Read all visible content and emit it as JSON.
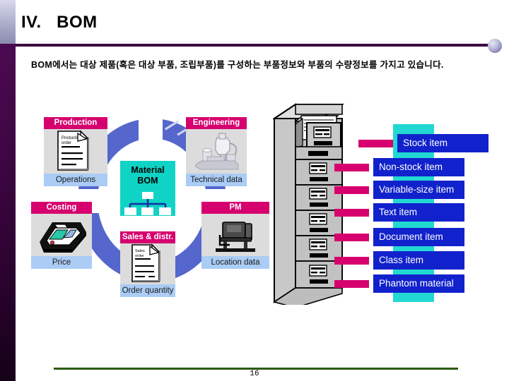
{
  "slide": {
    "title": "IV.   BOM",
    "lead_text": "BOM에서는 대상 제품(혹은 대상 부품, 조립부품)를 구성하는 부품정보와 부품의 수량정보를 가지고 있습니다.",
    "page_number": "16"
  },
  "colors": {
    "module_header": "#d6006e",
    "module_footer": "#aaccf5",
    "module_body": "#dcdcdc",
    "ring_blue": "#5566cc",
    "bom_cyan": "#0fd3c4",
    "item_chip_blue": "#1122cc",
    "item_panel_cyan": "#22d8d2",
    "connector_magenta": "#d6006e",
    "title_rule_purple": "#3d0640",
    "footer_rule_green": "#2d5a10",
    "left_bar_purple": "#3d0642"
  },
  "center": {
    "label_line1": "Material",
    "label_line2": "BOM",
    "icon": "hierarchy-tree-icon"
  },
  "modules": [
    {
      "id": "production",
      "header": "Production",
      "footer": "Operations",
      "icon": "production-order-document-icon",
      "icon_caption": "Production order"
    },
    {
      "id": "engineering",
      "header": "Engineering",
      "footer": "Technical data",
      "icon": "machine-assembly-icon"
    },
    {
      "id": "costing",
      "header": "Costing",
      "footer": "Price",
      "icon": "calculator-icon"
    },
    {
      "id": "pm",
      "header": "PM",
      "footer": "Location data",
      "icon": "machine-equipment-icon"
    },
    {
      "id": "sales",
      "header": "Sales & distr.",
      "footer": "Order quantity",
      "icon": "sales-order-document-icon",
      "icon_caption": "Sales order"
    }
  ],
  "cabinet": {
    "icon": "filing-cabinet-icon",
    "drawer_count": 6,
    "open_drawer_index": 0
  },
  "items": [
    {
      "label": "Stock item"
    },
    {
      "label": "Non-stock item"
    },
    {
      "label": "Variable-size item"
    },
    {
      "label": "Text item"
    },
    {
      "label": "Document item"
    },
    {
      "label": "Class item"
    },
    {
      "label": "Phantom material"
    }
  ]
}
